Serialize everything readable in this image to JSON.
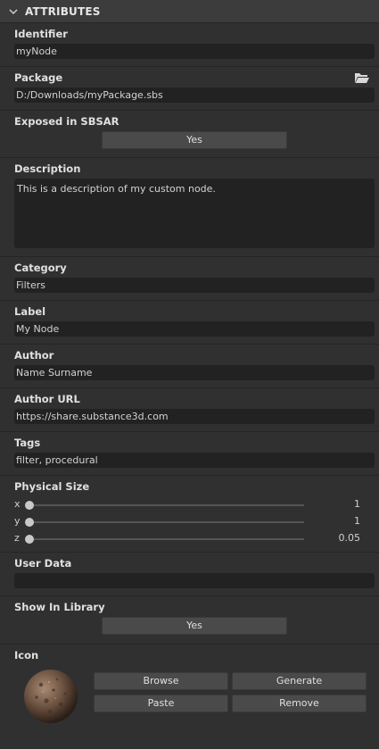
{
  "header": {
    "title": "ATTRIBUTES"
  },
  "identifier": {
    "label": "Identifier",
    "value": "myNode"
  },
  "package": {
    "label": "Package",
    "value": "D:/Downloads/myPackage.sbs"
  },
  "exposed": {
    "label": "Exposed in SBSAR",
    "value": "Yes"
  },
  "description": {
    "label": "Description",
    "value": "This is a description of my custom node."
  },
  "category": {
    "label": "Category",
    "value": "Filters"
  },
  "node_label": {
    "label": "Label",
    "value": "My Node"
  },
  "author": {
    "label": "Author",
    "value": "Name Surname"
  },
  "author_url": {
    "label": "Author URL",
    "value": "https://share.substance3d.com"
  },
  "tags": {
    "label": "Tags",
    "value": "filter, procedural"
  },
  "physical_size": {
    "label": "Physical Size",
    "axes": [
      {
        "axis": "x",
        "value": "1"
      },
      {
        "axis": "y",
        "value": "1"
      },
      {
        "axis": "z",
        "value": "0.05"
      }
    ]
  },
  "user_data": {
    "label": "User Data",
    "value": ""
  },
  "show_in_library": {
    "label": "Show In Library",
    "value": "Yes"
  },
  "icon": {
    "label": "Icon",
    "buttons": {
      "browse": "Browse",
      "generate": "Generate",
      "paste": "Paste",
      "remove": "Remove"
    }
  },
  "colors": {
    "panel_bg": "#303030",
    "header_bg": "#3c3c3c",
    "field_bg": "#222222",
    "button_bg": "#4a4a4a"
  },
  "icons": [
    "chevron-down-icon",
    "folder-icon",
    "material-sphere-icon"
  ]
}
